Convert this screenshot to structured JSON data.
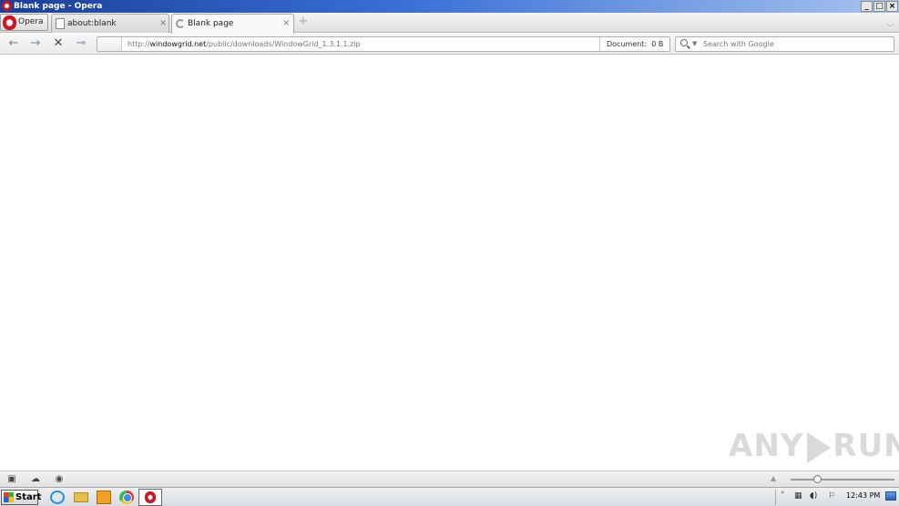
{
  "window": {
    "title": "Blank page - Opera",
    "controls": {
      "minimize": "_",
      "maximize": "□",
      "close": "×"
    }
  },
  "tabbar": {
    "menu_label": "Opera",
    "tabs": [
      {
        "label": "about:blank",
        "active": false,
        "close": "×"
      },
      {
        "label": "Blank page",
        "active": true,
        "close": "×"
      }
    ],
    "new_tab": "+"
  },
  "navbar": {
    "back": "←",
    "forward": "→",
    "stop": "✕",
    "key": "⊸",
    "address": {
      "prefix": "http://",
      "host": "windowgrid.net",
      "path": "/public/downloads/WindowGrid_1.3.1.1.zip"
    },
    "document_label": "Document:",
    "document_size": "0 B",
    "search_placeholder": "Search with Google"
  },
  "watermark": {
    "left": "ANY",
    "right": "RUN"
  },
  "statusbar": {
    "icons": [
      "panel-icon",
      "cloud-icon",
      "speed-dial-icon"
    ],
    "zoom_level": 0.25
  },
  "taskbar": {
    "start_label": "Start",
    "apps": [
      "internet-explorer-icon",
      "folder-icon",
      "media-player-icon",
      "chrome-icon",
      "opera-icon"
    ],
    "clock": "12:43 PM"
  },
  "colors": {
    "title_bar_start": "#1a3f9a",
    "opera_red": "#cc1622"
  }
}
